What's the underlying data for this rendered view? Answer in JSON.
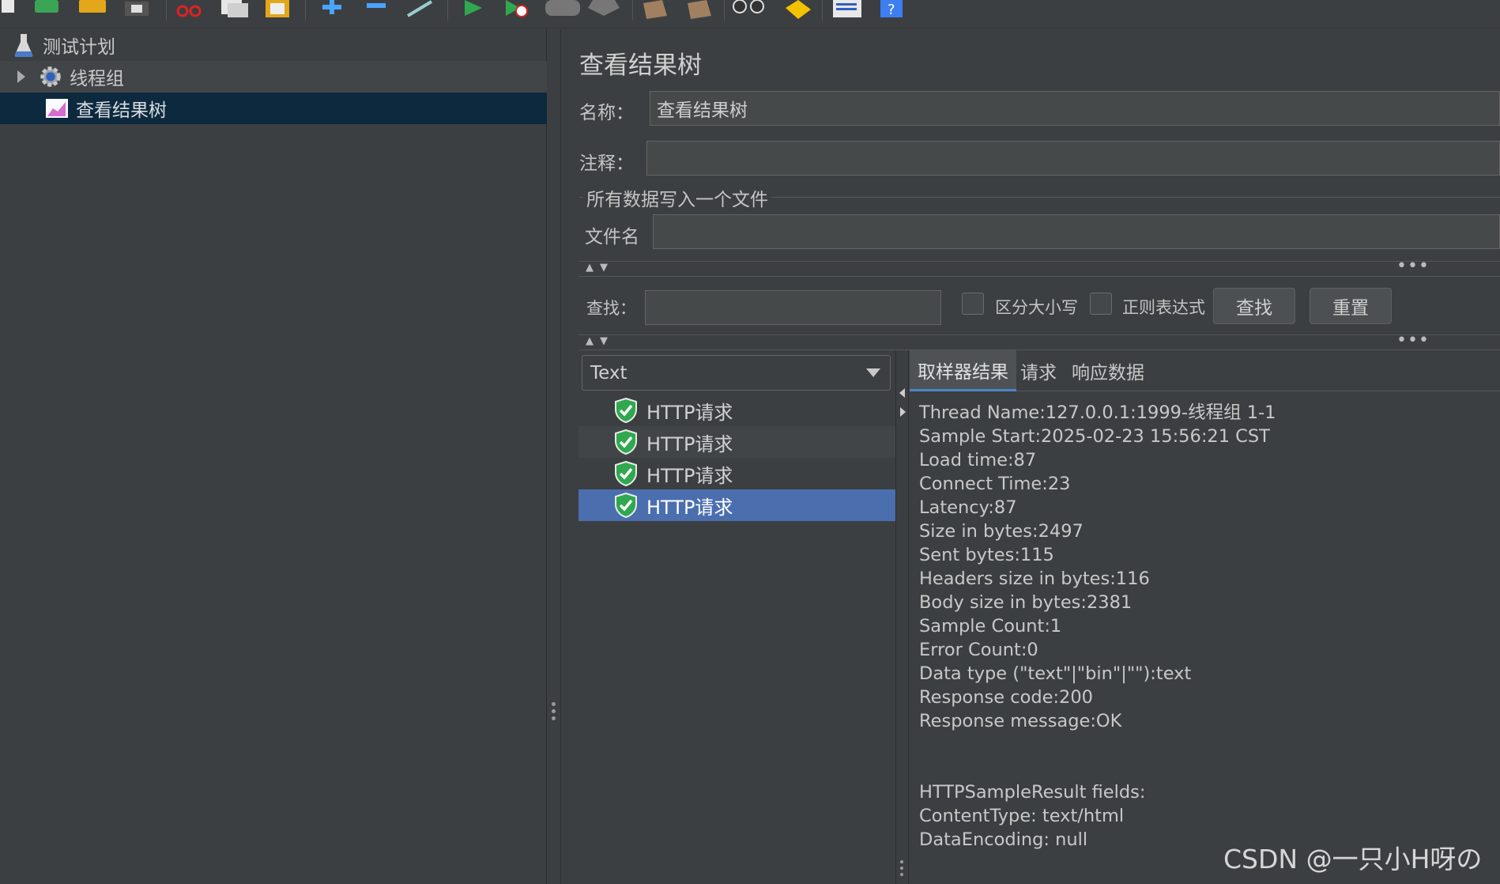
{
  "tree": {
    "items": [
      {
        "label": "测试计划",
        "icon": "flask-icon"
      },
      {
        "label": "线程组",
        "icon": "gear-icon"
      },
      {
        "label": "查看结果树",
        "icon": "chart-icon"
      }
    ]
  },
  "panel": {
    "title": "查看结果树",
    "name_label": "名称：",
    "name_value": "查看结果树",
    "comment_label": "注释：",
    "comment_value": "",
    "file_group_title": "所有数据写入一个文件",
    "filename_label": "文件名",
    "filename_value": ""
  },
  "search": {
    "label": "查找：",
    "value": "",
    "case_sensitive_label": "区分大小写",
    "regex_label": "正则表达式",
    "find_button": "查找",
    "reset_button": "重置"
  },
  "renderer": {
    "selected": "Text"
  },
  "results": [
    {
      "label": "HTTP请求",
      "status": "success"
    },
    {
      "label": "HTTP请求",
      "status": "success"
    },
    {
      "label": "HTTP请求",
      "status": "success"
    },
    {
      "label": "HTTP请求",
      "status": "success"
    }
  ],
  "tabs": [
    "取样器结果",
    "请求",
    "响应数据"
  ],
  "sampler_result": {
    "lines": [
      "Thread Name:127.0.0.1:1999-线程组 1-1",
      "Sample Start:2025-02-23 15:56:21 CST",
      "Load time:87",
      "Connect Time:23",
      "Latency:87",
      "Size in bytes:2497",
      "Sent bytes:115",
      "Headers size in bytes:116",
      "Body size in bytes:2381",
      "Sample Count:1",
      "Error Count:0",
      "Data type (\"text\"|\"bin\"|\"\"):text",
      "Response code:200",
      "Response message:OK",
      "",
      "",
      "HTTPSampleResult fields:",
      "ContentType: text/html",
      "DataEncoding: null"
    ]
  },
  "watermark": "CSDN @一只小H呀の",
  "colors": {
    "background": "#3c3f41",
    "tree_selected": "#0d293e",
    "list_selected": "#4b6eaf",
    "success_green": "#2fa84f"
  }
}
